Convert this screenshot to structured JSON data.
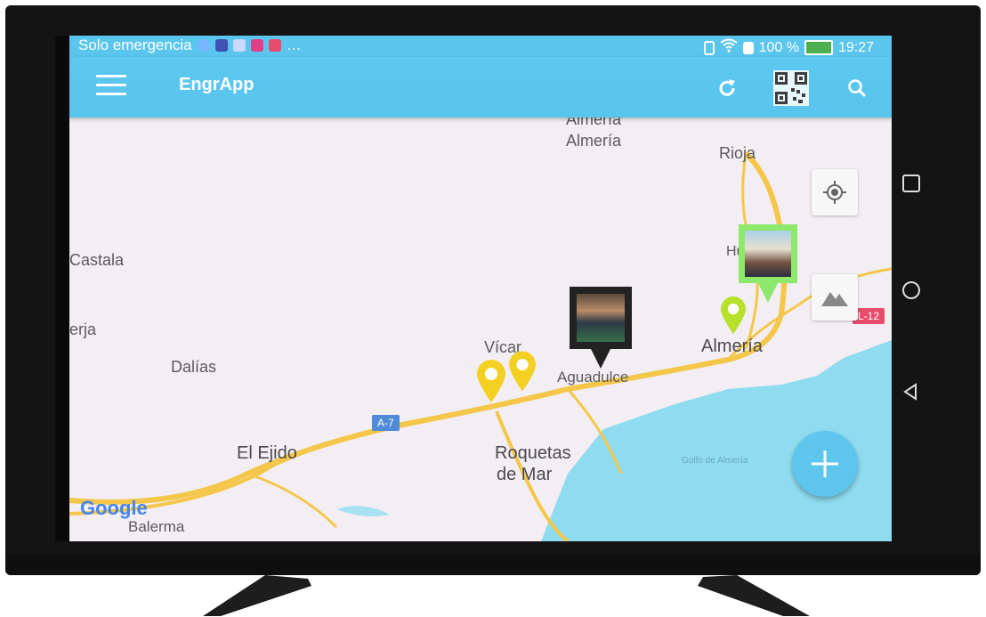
{
  "status": {
    "carrier": "Solo emergencia",
    "battery": "100 %",
    "time": "19:27"
  },
  "app": {
    "title": "EngrApp",
    "menu_icon": "menu-icon",
    "refresh_icon": "refresh-icon",
    "qr_icon": "qr-code-icon",
    "search_icon": "search-icon"
  },
  "map": {
    "towns": {
      "almeria_top": "Almería",
      "rioja": "Rioja",
      "castala": "Castala",
      "enix": "erja",
      "dalias": "Dalías",
      "vicar": "Vícar",
      "aguadulce": "Aguadulce",
      "almeria": "Almería",
      "el_ejido": "El Ejido",
      "roquetas_1": "Roquetas",
      "roquetas_2": "de Mar",
      "golfo": "Golfo de Almería",
      "balerma": "Balerma",
      "huercal": "Hu",
      "road_a7": "A-7",
      "road_l12": "L-12"
    },
    "attribution": "Google",
    "colors": {
      "land": "#f3eef3",
      "sea": "#8fdcf0",
      "roads": "#f4c74a",
      "appbar": "#5ac5ed",
      "fab": "#5ec6ec"
    }
  },
  "controls": {
    "locate_icon": "my-location-icon",
    "terrain_icon": "terrain-icon",
    "fab_icon": "plus-icon"
  },
  "system_nav": [
    "square-recent-icon",
    "circle-home-icon",
    "triangle-back-icon"
  ]
}
